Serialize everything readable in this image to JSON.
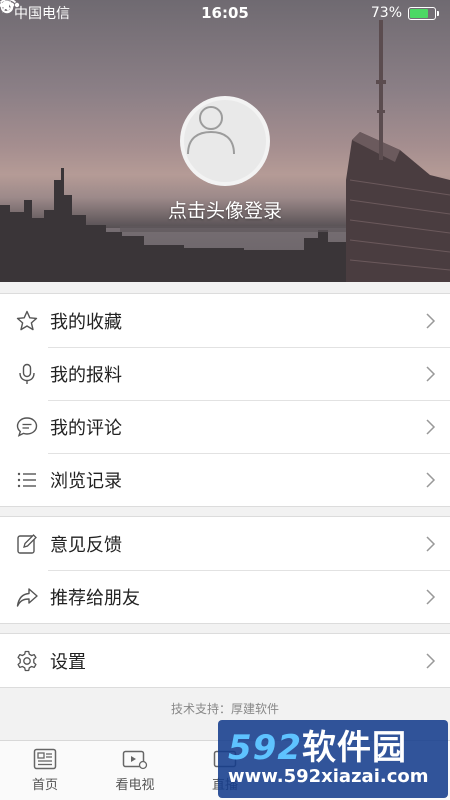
{
  "status_bar": {
    "carrier": "中国电信",
    "time": "16:05",
    "battery_percent": "73%",
    "battery_level": 0.73
  },
  "profile": {
    "login_prompt": "点击头像登录"
  },
  "menu_group_1": [
    {
      "label": "我的收藏",
      "icon": "star-icon"
    },
    {
      "label": "我的报料",
      "icon": "microphone-icon"
    },
    {
      "label": "我的评论",
      "icon": "comment-icon"
    },
    {
      "label": "浏览记录",
      "icon": "list-icon"
    }
  ],
  "menu_group_2": [
    {
      "label": "意见反馈",
      "icon": "edit-icon"
    },
    {
      "label": "推荐给朋友",
      "icon": "share-icon"
    }
  ],
  "menu_group_3": [
    {
      "label": "设置",
      "icon": "gear-icon"
    }
  ],
  "support_text": "技术支持：厚建软件",
  "tabbar": [
    {
      "label": "首页",
      "icon": "news-icon"
    },
    {
      "label": "看电视",
      "icon": "tv-icon"
    },
    {
      "label": "直播",
      "icon": "live-icon"
    }
  ],
  "watermark": {
    "brand_number": "592",
    "brand_text": "软件园",
    "url": "www.592xiazai.com"
  },
  "colors": {
    "battery_fill": "#4cd964",
    "watermark_bg": "#143c8c"
  }
}
